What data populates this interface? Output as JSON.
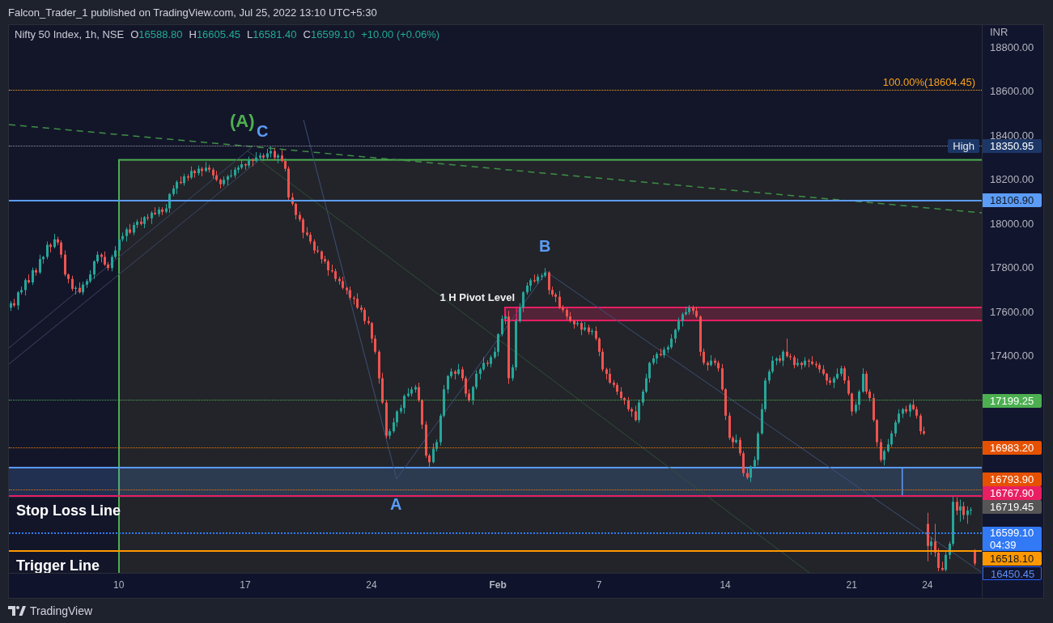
{
  "header": {
    "publisher": "Falcon_Trader_1 published on TradingView.com, Jul 25, 2022 13:10 UTC+5:30"
  },
  "legend": {
    "symbol": "Nifty 50 Index, 1h, NSE",
    "ohlc": [
      {
        "label": "O",
        "value": "16588.80"
      },
      {
        "label": "H",
        "value": "16605.45"
      },
      {
        "label": "L",
        "value": "16581.40"
      },
      {
        "label": "C",
        "value": "16599.10"
      }
    ],
    "change": "+10.00 (+0.06%)"
  },
  "wave_labels": [
    {
      "text": "(A)",
      "color": "#4caf50"
    },
    {
      "text": "C",
      "color": "#5b9cf6"
    },
    {
      "text": "B",
      "color": "#5b9cf6"
    },
    {
      "text": "A",
      "color": "#5b9cf6"
    }
  ],
  "price_tags": [
    {
      "kind": "filled",
      "value": "18350.95",
      "color": "#1c3766"
    },
    {
      "kind": "filled",
      "value": "18106.90",
      "color": "#5b9cf6"
    },
    {
      "kind": "filled",
      "value": "17199.25",
      "color": "#4caf50"
    },
    {
      "kind": "filled",
      "value": "16983.20",
      "color": "#e65100"
    },
    {
      "kind": "filled",
      "value": "16793.90",
      "color": "#e65100"
    },
    {
      "kind": "filled",
      "value": "16767.90",
      "color": "#e91e63"
    },
    {
      "kind": "filled",
      "value": "16719.45",
      "color": "#555555"
    },
    {
      "kind": "filled",
      "value": "16599.10",
      "countdown": "04:39",
      "color": "#3179f5"
    },
    {
      "kind": "filled",
      "value": "16518.10",
      "color": "#ff9800"
    },
    {
      "kind": "outlined",
      "value": "16450.45",
      "color": "#2962ff"
    }
  ],
  "chart": {
    "chart_data": {
      "type": "candlestick",
      "ylabel": "INR",
      "ylim": [
        16418,
        18901
      ],
      "yticks": [
        {
          "value": 18800,
          "label": "18800.00"
        },
        {
          "value": 18600,
          "label": "18600.00"
        },
        {
          "value": 18400,
          "label": "18400.00"
        },
        {
          "value": 18200,
          "label": "18200.00"
        },
        {
          "value": 18000,
          "label": "18000.00"
        },
        {
          "value": 17800,
          "label": "17800.00"
        },
        {
          "value": 17600,
          "label": "17600.00"
        },
        {
          "value": 17400,
          "label": "17400.00"
        }
      ],
      "ref_lines": [
        {
          "axis": "y",
          "value": 18604.45,
          "color": "#f7a21b",
          "label": "100.00%(18604.45)"
        },
        {
          "axis": "y",
          "value": 18350.95,
          "color": "#9598a1",
          "label": "High"
        },
        {
          "axis": "y",
          "value": 18106.9,
          "color": "#5b9cf6"
        },
        {
          "axis": "y",
          "value": 17199.25,
          "color": "#4caf50"
        },
        {
          "axis": "y",
          "value": 16983.2,
          "color": "#f57c00"
        },
        {
          "axis": "y",
          "value": 16793.9,
          "color": "#f57c00"
        },
        {
          "axis": "y",
          "value": 16767.9,
          "color": "#e91e63",
          "label": "Stop Loss Line"
        },
        {
          "axis": "y",
          "value": 16599.1,
          "color": "#2f7cf6"
        },
        {
          "axis": "y",
          "value": 16518.1,
          "color": "#ff9800",
          "label": "Trigger Line"
        }
      ],
      "bands": [
        {
          "axis": "y",
          "from": 16418,
          "to": 18290,
          "color": "#4caf50"
        },
        {
          "axis": "y",
          "from": 17562,
          "to": 17621,
          "color": "#e91e63",
          "label": "1 H Pivot Level"
        },
        {
          "axis": "y",
          "from": 16766,
          "to": 16895,
          "color": "#5b9cf6"
        }
      ],
      "categories": [
        null,
        null,
        null,
        null,
        null,
        null,
        null,
        null,
        null,
        null,
        null,
        null,
        null,
        null,
        null,
        null,
        null,
        null,
        null,
        null,
        null,
        null,
        null,
        null,
        null,
        null,
        null,
        null,
        null,
        null,
        "10",
        null,
        null,
        null,
        null,
        null,
        null,
        null,
        null,
        null,
        null,
        null,
        null,
        null,
        null,
        null,
        null,
        null,
        null,
        null,
        null,
        null,
        null,
        null,
        null,
        null,
        null,
        null,
        null,
        null,
        null,
        null,
        null,
        null,
        null,
        "17",
        null,
        null,
        null,
        null,
        null,
        null,
        null,
        null,
        null,
        null,
        null,
        null,
        null,
        null,
        null,
        null,
        null,
        null,
        null,
        null,
        null,
        null,
        null,
        null,
        null,
        null,
        null,
        null,
        null,
        null,
        null,
        null,
        null,
        null,
        "24",
        null,
        null,
        null,
        null,
        null,
        null,
        null,
        null,
        null,
        null,
        null,
        null,
        null,
        null,
        null,
        null,
        null,
        null,
        null,
        null,
        null,
        null,
        null,
        null,
        null,
        null,
        null,
        null,
        null,
        null,
        null,
        null,
        null,
        null,
        "Feb",
        null,
        null,
        null,
        null,
        null,
        null,
        null,
        null,
        null,
        null,
        null,
        null,
        null,
        null,
        null,
        null,
        null,
        null,
        null,
        null,
        null,
        null,
        null,
        null,
        null,
        null,
        null,
        "7",
        null,
        null,
        null,
        null,
        null,
        null,
        null,
        null,
        null,
        null,
        null,
        null,
        null,
        null,
        null,
        null,
        null,
        null,
        null,
        null,
        null,
        null,
        null,
        null,
        null,
        null,
        null,
        null,
        null,
        null,
        null,
        null,
        null,
        null,
        "14",
        null,
        null,
        null,
        null,
        null,
        null,
        null,
        null,
        null,
        null,
        null,
        null,
        null,
        null,
        null,
        null,
        null,
        null,
        null,
        null,
        null,
        null,
        null,
        null,
        null,
        null,
        null,
        null,
        null,
        null,
        null,
        null,
        null,
        null,
        "21",
        null,
        null,
        null,
        null,
        null,
        null,
        null,
        null,
        null,
        null,
        null,
        null,
        null,
        null,
        null,
        null,
        null,
        null,
        null,
        null,
        "24",
        null,
        null,
        null,
        null,
        null,
        null,
        null,
        null,
        null,
        null,
        null,
        null,
        null
      ],
      "ohlc": [
        [
          17620,
          17650,
          17605,
          17640
        ],
        [
          17640,
          17660,
          17622,
          17630
        ],
        [
          17630,
          17695,
          17610,
          17690
        ],
        [
          17690,
          17715,
          17680,
          17700
        ],
        [
          17700,
          17753,
          17675,
          17745
        ],
        [
          17745,
          17770,
          17729,
          17735
        ],
        [
          17735,
          17802,
          17723,
          17790
        ],
        [
          17790,
          17800,
          17765,
          17780
        ],
        [
          17780,
          17860,
          17772,
          17840
        ],
        [
          17840,
          17855,
          17820,
          17850
        ],
        [
          17850,
          17920,
          17840,
          17905
        ],
        [
          17905,
          17913,
          17870,
          17895
        ],
        [
          17895,
          17955,
          17889,
          17930
        ],
        [
          17930,
          17942,
          17903,
          17915
        ],
        [
          17915,
          17925,
          17845,
          17860
        ],
        [
          17860,
          17880,
          17762,
          17770
        ],
        [
          17770,
          17775,
          17730,
          17750
        ],
        [
          17750,
          17765,
          17695,
          17705
        ],
        [
          17705,
          17718,
          17680,
          17710
        ],
        [
          17710,
          17735,
          17684,
          17690
        ],
        [
          17690,
          17737,
          17678,
          17725
        ],
        [
          17725,
          17750,
          17710,
          17740
        ],
        [
          17740,
          17790,
          17732,
          17770
        ],
        [
          17770,
          17835,
          17750,
          17830
        ],
        [
          17830,
          17875,
          17820,
          17860
        ],
        [
          17860,
          17868,
          17825,
          17850
        ],
        [
          17850,
          17875,
          17809,
          17815
        ],
        [
          17815,
          17827,
          17788,
          17800
        ],
        [
          17800,
          17860,
          17785,
          17850
        ],
        [
          17850,
          17900,
          17842,
          17880
        ],
        [
          17880,
          17935,
          17860,
          17930
        ],
        [
          17930,
          17960,
          17920,
          17945
        ],
        [
          17945,
          17983,
          17920,
          17975
        ],
        [
          17975,
          18000,
          17954,
          17960
        ],
        [
          17960,
          18007,
          17948,
          17995
        ],
        [
          17995,
          18020,
          17980,
          18010
        ],
        [
          18010,
          18030,
          17992,
          18000
        ],
        [
          18000,
          18035,
          17980,
          18030
        ],
        [
          18030,
          18045,
          18015,
          18025
        ],
        [
          18025,
          18058,
          18000,
          18050
        ],
        [
          18050,
          18075,
          18039,
          18045
        ],
        [
          18045,
          18077,
          18033,
          18065
        ],
        [
          18065,
          18075,
          18040,
          18055
        ],
        [
          18055,
          18090,
          18047,
          18070
        ],
        [
          18070,
          18140,
          18050,
          18135
        ],
        [
          18135,
          18175,
          18125,
          18160
        ],
        [
          18160,
          18198,
          18135,
          18190
        ],
        [
          18190,
          18215,
          18179,
          18185
        ],
        [
          18185,
          18227,
          18173,
          18215
        ],
        [
          18215,
          18225,
          18195,
          18210
        ],
        [
          18210,
          18260,
          18202,
          18240
        ],
        [
          18240,
          18245,
          18210,
          18230
        ],
        [
          18230,
          18265,
          18220,
          18250
        ],
        [
          18250,
          18258,
          18215,
          18240
        ],
        [
          18240,
          18280,
          18234,
          18255
        ],
        [
          18255,
          18267,
          18233,
          18245
        ],
        [
          18245,
          18255,
          18205,
          18220
        ],
        [
          18220,
          18240,
          18192,
          18200
        ],
        [
          18200,
          18205,
          18160,
          18180
        ],
        [
          18180,
          18215,
          18170,
          18200
        ],
        [
          18200,
          18223,
          18175,
          18215
        ],
        [
          18215,
          18245,
          18209,
          18220
        ],
        [
          18220,
          18257,
          18208,
          18245
        ],
        [
          18245,
          18265,
          18230,
          18255
        ],
        [
          18255,
          18290,
          18247,
          18270
        ],
        [
          18270,
          18275,
          18245,
          18265
        ],
        [
          18265,
          18305,
          18255,
          18290
        ],
        [
          18290,
          18298,
          18260,
          18285
        ],
        [
          18285,
          18325,
          18279,
          18300
        ],
        [
          18300,
          18322,
          18288,
          18310
        ],
        [
          18310,
          18320,
          18285,
          18300
        ],
        [
          18300,
          18340,
          18292,
          18320
        ],
        [
          18320,
          18351,
          18300,
          18330
        ],
        [
          18330,
          18345,
          18290,
          18300
        ],
        [
          18300,
          18318,
          18275,
          18310
        ],
        [
          18310,
          18335,
          18279,
          18285
        ],
        [
          18285,
          18297,
          18238,
          18250
        ],
        [
          18250,
          18260,
          18105,
          18120
        ],
        [
          18120,
          18140,
          18082,
          18090
        ],
        [
          18090,
          18095,
          18020,
          18040
        ],
        [
          18040,
          18055,
          18010,
          18020
        ],
        [
          18020,
          18028,
          17935,
          17960
        ],
        [
          17960,
          17985,
          17944,
          17950
        ],
        [
          17950,
          17962,
          17908,
          17920
        ],
        [
          17920,
          17930,
          17865,
          17880
        ],
        [
          17880,
          17900,
          17867,
          17875
        ],
        [
          17875,
          17880,
          17820,
          17840
        ],
        [
          17840,
          17855,
          17820,
          17830
        ],
        [
          17830,
          17838,
          17765,
          17790
        ],
        [
          17790,
          17815,
          17779,
          17785
        ],
        [
          17785,
          17797,
          17738,
          17750
        ],
        [
          17750,
          17760,
          17725,
          17740
        ],
        [
          17740,
          17760,
          17702,
          17710
        ],
        [
          17710,
          17715,
          17680,
          17700
        ],
        [
          17700,
          17715,
          17655,
          17665
        ],
        [
          17665,
          17673,
          17635,
          17660
        ],
        [
          17660,
          17685,
          17614,
          17620
        ],
        [
          17620,
          17632,
          17598,
          17610
        ],
        [
          17610,
          17620,
          17545,
          17560
        ],
        [
          17560,
          17580,
          17542,
          17550
        ],
        [
          17550,
          17555,
          17460,
          17480
        ],
        [
          17480,
          17495,
          17410,
          17420
        ],
        [
          17420,
          17428,
          17275,
          17300
        ],
        [
          17300,
          17325,
          17184,
          17190
        ],
        [
          17190,
          17202,
          17028,
          17040
        ],
        [
          17040,
          17070,
          17025,
          17060
        ],
        [
          17060,
          17120,
          17052,
          17100
        ],
        [
          17100,
          17155,
          17080,
          17150
        ],
        [
          17150,
          17180,
          17140,
          17165
        ],
        [
          17165,
          17228,
          17140,
          17220
        ],
        [
          17220,
          17255,
          17214,
          17230
        ],
        [
          17230,
          17262,
          17218,
          17250
        ],
        [
          17250,
          17270,
          17235,
          17260
        ],
        [
          17260,
          17280,
          17192,
          17200
        ],
        [
          17200,
          17205,
          17070,
          17090
        ],
        [
          17090,
          17105,
          16940,
          16950
        ],
        [
          16950,
          16958,
          16895,
          16920
        ],
        [
          16920,
          17005,
          16914,
          16980
        ],
        [
          16980,
          17022,
          16968,
          17010
        ],
        [
          17010,
          17140,
          16995,
          17130
        ],
        [
          17130,
          17270,
          17122,
          17250
        ],
        [
          17250,
          17315,
          17230,
          17310
        ],
        [
          17310,
          17345,
          17300,
          17330
        ],
        [
          17330,
          17338,
          17295,
          17320
        ],
        [
          17320,
          17365,
          17314,
          17340
        ],
        [
          17340,
          17352,
          17288,
          17300
        ],
        [
          17300,
          17310,
          17215,
          17230
        ],
        [
          17230,
          17250,
          17192,
          17200
        ],
        [
          17200,
          17265,
          17180,
          17260
        ],
        [
          17260,
          17335,
          17250,
          17320
        ],
        [
          17320,
          17348,
          17295,
          17340
        ],
        [
          17340,
          17395,
          17334,
          17370
        ],
        [
          17370,
          17382,
          17353,
          17365
        ],
        [
          17365,
          17405,
          17350,
          17395
        ],
        [
          17395,
          17440,
          17387,
          17420
        ],
        [
          17420,
          17505,
          17400,
          17500
        ],
        [
          17500,
          17585,
          17490,
          17570
        ],
        [
          17570,
          17588,
          17545,
          17580
        ],
        [
          17580,
          17605,
          17274,
          17300
        ],
        [
          17300,
          17362,
          17288,
          17350
        ],
        [
          17350,
          17570,
          17335,
          17560
        ],
        [
          17560,
          17640,
          17552,
          17620
        ],
        [
          17620,
          17695,
          17600,
          17690
        ],
        [
          17690,
          17735,
          17680,
          17720
        ],
        [
          17720,
          17753,
          17695,
          17745
        ],
        [
          17745,
          17770,
          17734,
          17740
        ],
        [
          17740,
          17772,
          17728,
          17760
        ],
        [
          17760,
          17775,
          17745,
          17765
        ],
        [
          17765,
          17800,
          17757,
          17780
        ],
        [
          17780,
          17785,
          17680,
          17700
        ],
        [
          17700,
          17715,
          17670,
          17680
        ],
        [
          17680,
          17688,
          17645,
          17670
        ],
        [
          17670,
          17695,
          17614,
          17620
        ],
        [
          17620,
          17632,
          17598,
          17610
        ],
        [
          17610,
          17620,
          17565,
          17580
        ],
        [
          17580,
          17600,
          17552,
          17560
        ],
        [
          17560,
          17565,
          17525,
          17545
        ],
        [
          17545,
          17565,
          17535,
          17550
        ],
        [
          17550,
          17558,
          17495,
          17520
        ],
        [
          17520,
          17555,
          17514,
          17530
        ],
        [
          17530,
          17542,
          17498,
          17510
        ],
        [
          17510,
          17525,
          17495,
          17515
        ],
        [
          17515,
          17535,
          17472,
          17480
        ],
        [
          17480,
          17485,
          17400,
          17420
        ],
        [
          17420,
          17435,
          17330,
          17340
        ],
        [
          17340,
          17348,
          17295,
          17320
        ],
        [
          17320,
          17345,
          17274,
          17280
        ],
        [
          17280,
          17292,
          17258,
          17270
        ],
        [
          17270,
          17280,
          17225,
          17240
        ],
        [
          17240,
          17260,
          17202,
          17210
        ],
        [
          17210,
          17215,
          17180,
          17200
        ],
        [
          17200,
          17215,
          17150,
          17160
        ],
        [
          17160,
          17168,
          17125,
          17150
        ],
        [
          17150,
          17175,
          17104,
          17110
        ],
        [
          17110,
          17202,
          17098,
          17190
        ],
        [
          17190,
          17250,
          17175,
          17240
        ],
        [
          17240,
          17320,
          17232,
          17300
        ],
        [
          17300,
          17375,
          17280,
          17370
        ],
        [
          17370,
          17405,
          17360,
          17390
        ],
        [
          17390,
          17418,
          17365,
          17410
        ],
        [
          17410,
          17435,
          17399,
          17405
        ],
        [
          17405,
          17442,
          17393,
          17430
        ],
        [
          17430,
          17450,
          17415,
          17440
        ],
        [
          17440,
          17500,
          17432,
          17480
        ],
        [
          17480,
          17525,
          17460,
          17520
        ],
        [
          17520,
          17575,
          17510,
          17560
        ],
        [
          17560,
          17598,
          17535,
          17590
        ],
        [
          17590,
          17625,
          17584,
          17600
        ],
        [
          17600,
          17632,
          17588,
          17620
        ],
        [
          17620,
          17630,
          17590,
          17605
        ],
        [
          17605,
          17625,
          17572,
          17580
        ],
        [
          17580,
          17585,
          17400,
          17420
        ],
        [
          17420,
          17435,
          17360,
          17370
        ],
        [
          17370,
          17378,
          17335,
          17360
        ],
        [
          17360,
          17405,
          17354,
          17380
        ],
        [
          17380,
          17392,
          17358,
          17370
        ],
        [
          17370,
          17380,
          17330,
          17345
        ],
        [
          17345,
          17365,
          17242,
          17250
        ],
        [
          17250,
          17255,
          17110,
          17130
        ],
        [
          17130,
          17145,
          17020,
          17030
        ],
        [
          17030,
          17038,
          16985,
          17010
        ],
        [
          17010,
          17045,
          17004,
          17020
        ],
        [
          17020,
          17032,
          16948,
          16960
        ],
        [
          16960,
          16970,
          16855,
          16870
        ],
        [
          16870,
          16890,
          16842,
          16850
        ],
        [
          16850,
          16905,
          16830,
          16900
        ],
        [
          16900,
          16945,
          16890,
          16930
        ],
        [
          16930,
          17058,
          16905,
          17050
        ],
        [
          17050,
          17185,
          17044,
          17160
        ],
        [
          17160,
          17302,
          17148,
          17290
        ],
        [
          17290,
          17340,
          17275,
          17330
        ],
        [
          17330,
          17400,
          17322,
          17380
        ],
        [
          17380,
          17395,
          17360,
          17390
        ],
        [
          17390,
          17405,
          17370,
          17380
        ],
        [
          17380,
          17428,
          17355,
          17420
        ],
        [
          17420,
          17480,
          17394,
          17400
        ],
        [
          17400,
          17412,
          17383,
          17395
        ],
        [
          17395,
          17405,
          17345,
          17360
        ],
        [
          17360,
          17390,
          17352,
          17370
        ],
        [
          17370,
          17375,
          17340,
          17360
        ],
        [
          17360,
          17395,
          17350,
          17380
        ],
        [
          17380,
          17388,
          17350,
          17375
        ],
        [
          17375,
          17400,
          17359,
          17365
        ],
        [
          17365,
          17377,
          17348,
          17360
        ],
        [
          17360,
          17370,
          17325,
          17340
        ],
        [
          17340,
          17360,
          17312,
          17320
        ],
        [
          17320,
          17325,
          17270,
          17290
        ],
        [
          17290,
          17305,
          17270,
          17280
        ],
        [
          17280,
          17308,
          17255,
          17300
        ],
        [
          17300,
          17345,
          17294,
          17320
        ],
        [
          17320,
          17357,
          17308,
          17345
        ],
        [
          17345,
          17355,
          17275,
          17290
        ],
        [
          17290,
          17310,
          17222,
          17230
        ],
        [
          17230,
          17235,
          17130,
          17150
        ],
        [
          17150,
          17195,
          17140,
          17180
        ],
        [
          17180,
          17248,
          17155,
          17240
        ],
        [
          17240,
          17345,
          17234,
          17320
        ],
        [
          17320,
          17332,
          17228,
          17240
        ],
        [
          17240,
          17250,
          17195,
          17210
        ],
        [
          17210,
          17230,
          17102,
          17110
        ],
        [
          17110,
          17115,
          16990,
          17010
        ],
        [
          17010,
          17025,
          16920,
          16930
        ],
        [
          16930,
          16978,
          16905,
          16970
        ],
        [
          16970,
          17025,
          16964,
          17000
        ],
        [
          17000,
          17062,
          16988,
          17050
        ],
        [
          17050,
          17110,
          17035,
          17100
        ],
        [
          17100,
          17160,
          17092,
          17140
        ],
        [
          17140,
          17165,
          17120,
          17160
        ],
        [
          17160,
          17175,
          17140,
          17150
        ],
        [
          17150,
          17188,
          17125,
          17180
        ],
        [
          17180,
          17205,
          17154,
          17160
        ],
        [
          17160,
          17172,
          17118,
          17130
        ],
        [
          17130,
          17140,
          17045,
          17060
        ],
        [
          17060,
          17080,
          17042,
          17050
        ],
        [
          16640,
          16690,
          16470,
          16540
        ],
        [
          16540,
          16580,
          16500,
          16560
        ],
        [
          16560,
          16640,
          16490,
          16510
        ],
        [
          16510,
          16530,
          16425,
          16440
        ],
        [
          16440,
          16468,
          16426,
          16432
        ],
        [
          16432,
          16520,
          16424,
          16500
        ],
        [
          16500,
          16560,
          16480,
          16550
        ],
        [
          16550,
          16770,
          16540,
          16740
        ],
        [
          16740,
          16760,
          16680,
          16700
        ],
        [
          16700,
          16750,
          16650,
          16720
        ],
        [
          16720,
          16740,
          16660,
          16680
        ],
        [
          16680,
          16720,
          16640,
          16700
        ],
        [
          16700,
          16715,
          16680,
          16705
        ],
        [
          16520,
          16525,
          16450,
          16460
        ]
      ]
    }
  },
  "footer": {
    "brand": "TradingView"
  }
}
